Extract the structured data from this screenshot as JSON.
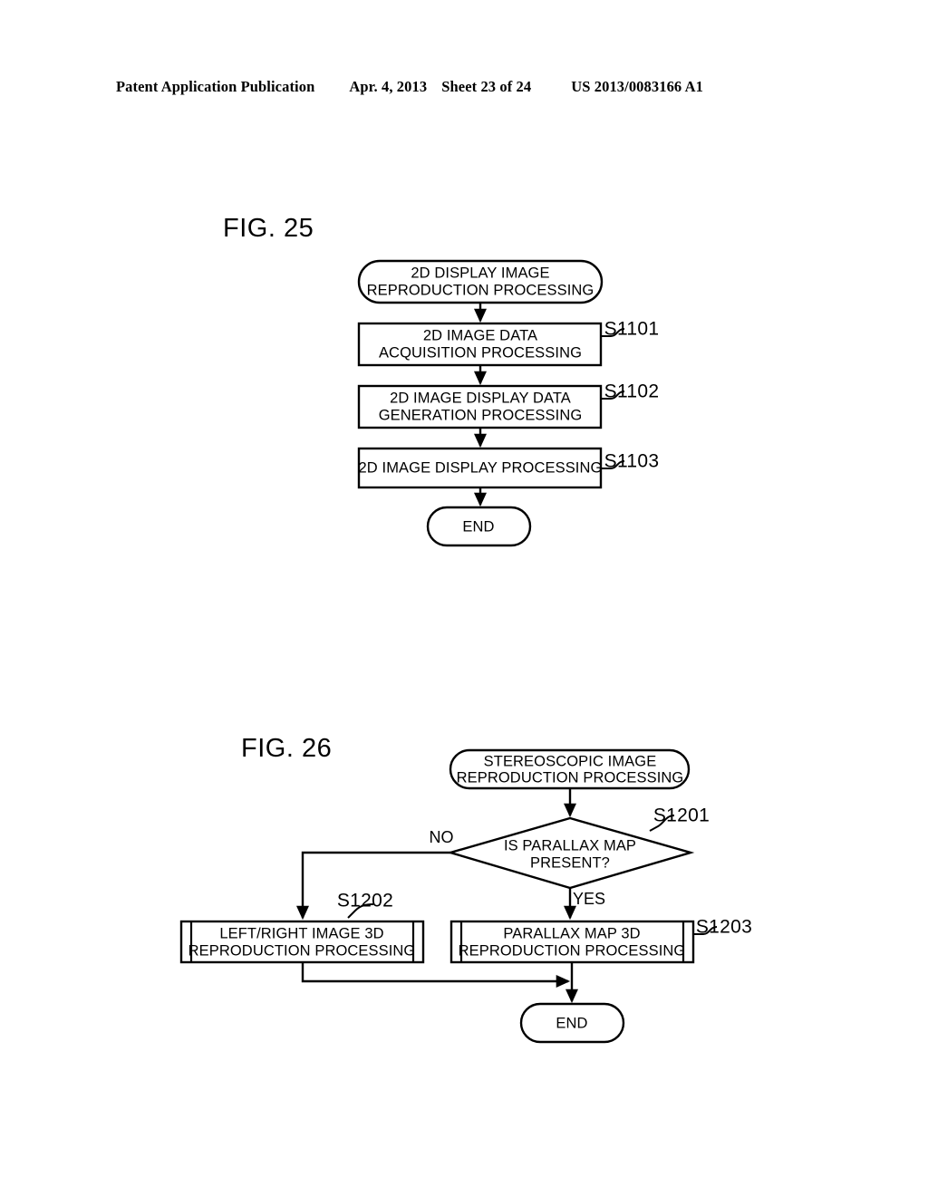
{
  "header": {
    "publication": "Patent Application Publication",
    "date": "Apr. 4, 2013",
    "sheet": "Sheet 23 of 24",
    "number": "US 2013/0083166 A1"
  },
  "figures": [
    {
      "label": "FIG. 25",
      "nodes": {
        "start": {
          "lines": [
            "2D DISPLAY IMAGE",
            "REPRODUCTION PROCESSING"
          ],
          "shape": "terminal"
        },
        "s1101": {
          "lines": [
            "2D IMAGE DATA",
            "ACQUISITION PROCESSING"
          ],
          "shape": "process",
          "step": "S1101"
        },
        "s1102": {
          "lines": [
            "2D IMAGE DISPLAY DATA",
            "GENERATION PROCESSING"
          ],
          "shape": "process",
          "step": "S1102"
        },
        "s1103": {
          "lines": [
            "2D IMAGE DISPLAY PROCESSING"
          ],
          "shape": "process",
          "step": "S1103"
        },
        "end": {
          "lines": [
            "END"
          ],
          "shape": "terminal"
        }
      }
    },
    {
      "label": "FIG. 26",
      "nodes": {
        "start": {
          "lines": [
            "STEREOSCOPIC IMAGE",
            "REPRODUCTION PROCESSING"
          ],
          "shape": "terminal"
        },
        "s1201": {
          "lines": [
            "IS PARALLAX MAP",
            "PRESENT?"
          ],
          "shape": "decision",
          "step": "S1201"
        },
        "s1202": {
          "lines": [
            "LEFT/RIGHT IMAGE 3D",
            "REPRODUCTION PROCESSING"
          ],
          "shape": "predefined-process",
          "step": "S1202"
        },
        "s1203": {
          "lines": [
            "PARALLAX MAP 3D",
            "REPRODUCTION PROCESSING"
          ],
          "shape": "predefined-process",
          "step": "S1203"
        },
        "end": {
          "lines": [
            "END"
          ],
          "shape": "terminal"
        }
      },
      "branches": {
        "no": "NO",
        "yes": "YES"
      }
    }
  ],
  "colors": {
    "ink": "#000000",
    "paper": "#ffffff"
  }
}
